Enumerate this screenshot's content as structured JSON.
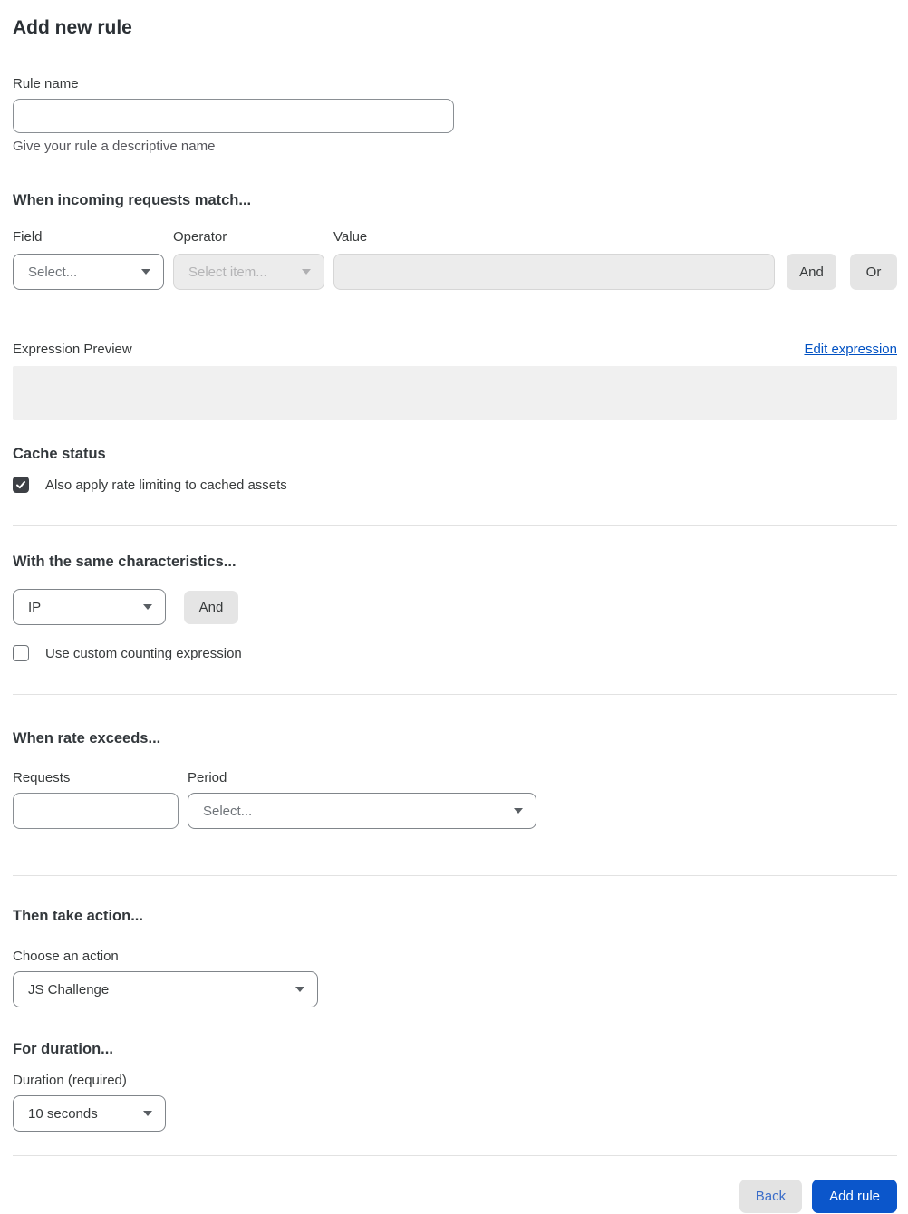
{
  "title": "Add new rule",
  "rule_name": {
    "label": "Rule name",
    "value": "",
    "placeholder": "",
    "help": "Give your rule a descriptive name"
  },
  "match": {
    "heading": "When incoming requests match...",
    "field_label": "Field",
    "field_value": "Select...",
    "operator_label": "Operator",
    "operator_value": "Select item...",
    "value_label": "Value",
    "value_text": "",
    "and_label": "And",
    "or_label": "Or"
  },
  "expression": {
    "preview_label": "Expression Preview",
    "edit_link": "Edit expression",
    "content": ""
  },
  "cache": {
    "heading": "Cache status",
    "checkbox_label": "Also apply rate limiting to cached assets",
    "checked": true
  },
  "characteristics": {
    "heading": "With the same characteristics...",
    "select_value": "IP",
    "and_label": "And",
    "checkbox_label": "Use custom counting expression",
    "checked": false
  },
  "rate": {
    "heading": "When rate exceeds...",
    "requests_label": "Requests",
    "requests_value": "",
    "period_label": "Period",
    "period_value": "Select..."
  },
  "action": {
    "heading": "Then take action...",
    "choose_label": "Choose an action",
    "selected": "JS Challenge"
  },
  "duration": {
    "heading": "For duration...",
    "label": "Duration (required)",
    "selected": "10 seconds"
  },
  "footer": {
    "back": "Back",
    "add_rule": "Add rule"
  },
  "colors": {
    "primary_button_blue": "#0b56cb",
    "link_blue": "#0051c3",
    "back_button_text_blue": "#3b6dc9",
    "checkbox_checked_dark": "#3d4045",
    "disabled_field_bg": "#ececec",
    "expression_preview_bg": "#f0f0f0",
    "divider_gray": "#e2e2e2"
  }
}
